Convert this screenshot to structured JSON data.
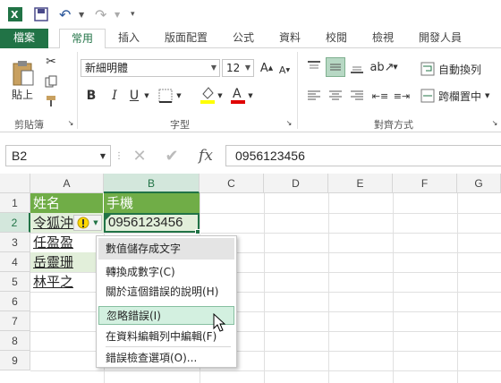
{
  "colors": {
    "excel_green": "#217346",
    "header_fill": "#70ad47",
    "selected_header": "#d3e7dc",
    "menu_hover": "#d3f0e0",
    "warning": "#ffd800"
  },
  "tabs": [
    "檔案",
    "常用",
    "插入",
    "版面配置",
    "公式",
    "資料",
    "校閱",
    "檢視",
    "開發人員"
  ],
  "active_tab": "常用",
  "ribbon": {
    "clipboard": {
      "paste_label": "貼上",
      "group_label": "剪貼簿"
    },
    "font": {
      "name": "新細明體",
      "size": "12",
      "group_label": "字型",
      "bold": "B",
      "italic": "I",
      "underline": "U"
    },
    "alignment": {
      "wrap_label": "自動換列",
      "merge_label": "跨欄置中",
      "group_label": "對齊方式"
    }
  },
  "formula_bar": {
    "name_box": "B2",
    "formula": "0956123456",
    "fx_label": "fx"
  },
  "columns": [
    "A",
    "B",
    "C",
    "D",
    "E",
    "F",
    "G"
  ],
  "rows": [
    "1",
    "2",
    "3",
    "4",
    "5",
    "6",
    "7",
    "8",
    "9"
  ],
  "cells": {
    "A1": "姓名",
    "B1": "手機",
    "A2": "令狐沖",
    "B2": "0956123456",
    "A3": "任盈盈",
    "A4": "岳靈珊",
    "A5": "林平之"
  },
  "context_menu": {
    "header": "數值儲存成文字",
    "items": [
      {
        "label": "轉換成數字(C)"
      },
      {
        "label": "關於這個錯誤的說明(H)"
      },
      {
        "label": "忽略錯誤(I)"
      },
      {
        "label": "在資料編輯列中編輯(F)"
      },
      {
        "label": "錯誤檢查選項(O)..."
      }
    ]
  }
}
